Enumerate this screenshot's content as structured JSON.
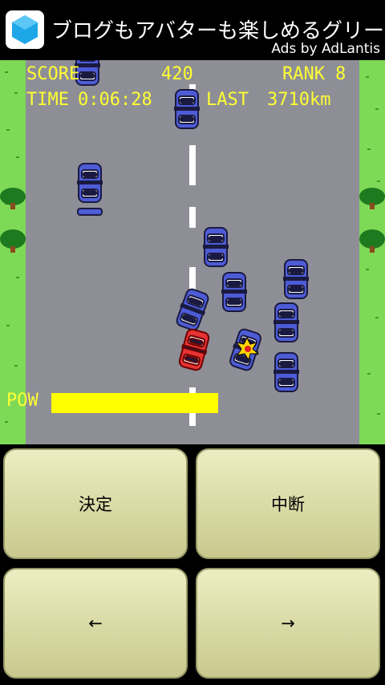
{
  "ad": {
    "title": "ブログもアバターも楽しめるグリー",
    "credit": "Ads by AdLantis",
    "logo_icon": "hexagon-app-icon",
    "accent": "#1ea7e8"
  },
  "hud": {
    "score_label": "SCORE",
    "score_value": "420",
    "rank_label": "RANK",
    "rank_value": "8",
    "time_label": "TIME",
    "time_value": "0:06:28",
    "last_label": "LAST",
    "last_value": "3710km",
    "pow_label": "POW",
    "pow_fraction": 0.52,
    "text_color": "#ffff33"
  },
  "colors": {
    "road": "#8e8e96",
    "grass": "#7ed957",
    "player_car": "#e63232",
    "enemy_car": "#4d5cd6",
    "pow_bar": "#ffff00"
  },
  "controls": {
    "confirm_label": "決定",
    "pause_label": "中断",
    "left_label": "←",
    "right_label": "→"
  }
}
